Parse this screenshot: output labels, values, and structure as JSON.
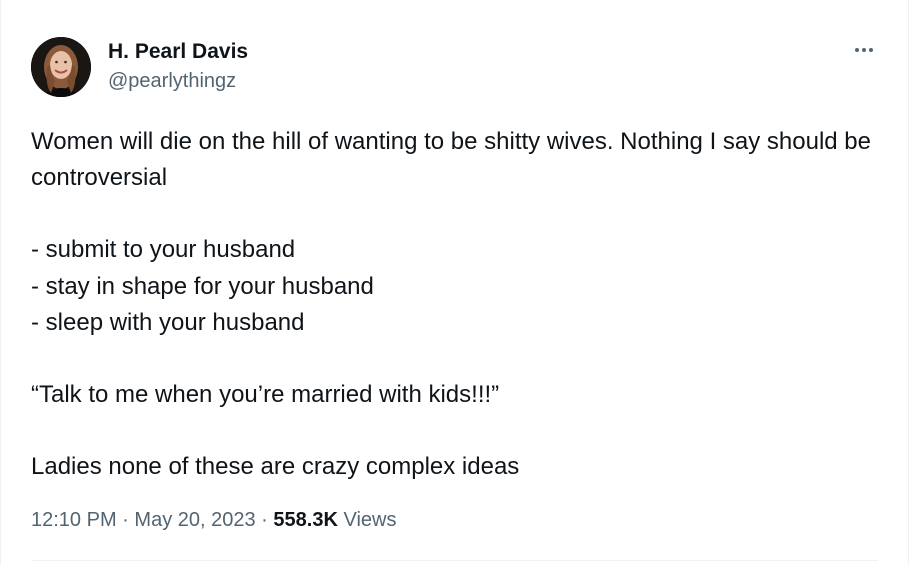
{
  "tweet": {
    "author": {
      "display_name": "H. Pearl Davis",
      "handle": "@pearlythingz",
      "avatar": "profile-photo"
    },
    "more_icon": "more-horizontal-icon",
    "text": {
      "line1": "Women will die on the hill of wanting to be shitty wives. Nothing I say should be controversial",
      "list": [
        "- submit to your husband",
        "- stay in shape for your husband",
        "- sleep with your husband"
      ],
      "quote": "“Talk to me when you’re married with kids!!!”",
      "closing": "Ladies none of these are crazy complex ideas"
    },
    "meta": {
      "time": "12:10 PM",
      "separator": "·",
      "date": "May 20, 2023",
      "views_count": "558.3K",
      "views_label": "Views"
    },
    "colors": {
      "primary_text": "#0f1419",
      "secondary_text": "#536471",
      "divider": "#eff3f4"
    }
  }
}
